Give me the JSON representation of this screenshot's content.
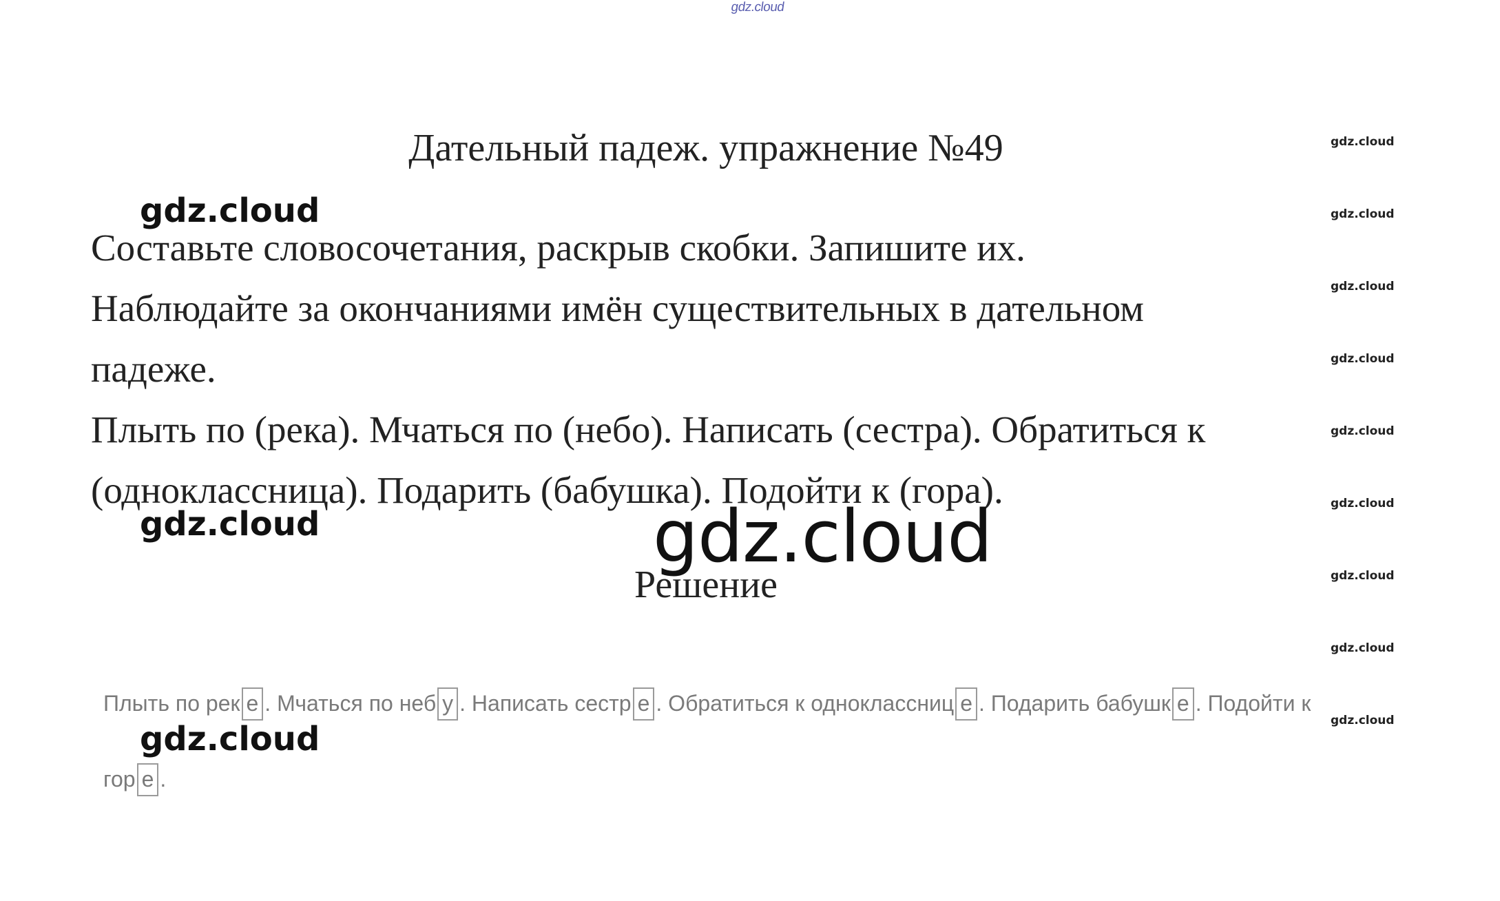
{
  "watermarks": {
    "top": "gdz.cloud",
    "side": [
      "gdz.cloud",
      "gdz.cloud",
      "gdz.cloud",
      "gdz.cloud",
      "gdz.cloud",
      "gdz.cloud",
      "gdz.cloud",
      "gdz.cloud",
      "gdz.cloud"
    ],
    "bold_1": "gdz.cloud",
    "bold_2": "gdz.cloud",
    "bold_3": "gdz.cloud",
    "huge": "gdz.cloud"
  },
  "title": "Дательный падеж. упражнение №49",
  "task": {
    "line1": "Составьте словосочетания, раскрыв скобки. Запишите их.",
    "line2": "Наблюдайте за окончаниями имён существительных в дательном",
    "line3": "падеже.",
    "line4": "Плыть по (река). Мчаться по (небо). Написать (сестра). Обратиться к",
    "line5": "(одноклассница). Подарить (бабушка). Подойти к (гора)."
  },
  "solution_heading": "Решение",
  "answer": {
    "segments": [
      {
        "text": "Плыть по рек",
        "ending": "е"
      },
      {
        "text": ". Мчаться по неб",
        "ending": "у"
      },
      {
        "text": ". Написать сестр",
        "ending": "е"
      },
      {
        "text": ". Обратиться к одноклассниц",
        "ending": "е"
      },
      {
        "text": ". Подарить бабушк",
        "ending": "е"
      },
      {
        "text": ". Подойти к",
        "ending": null
      }
    ],
    "line2": {
      "text": "гор",
      "ending": "е",
      "tail": "."
    }
  }
}
